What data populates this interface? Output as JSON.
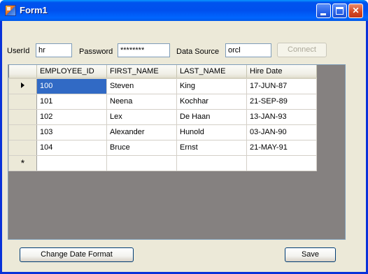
{
  "window": {
    "title": "Form1",
    "colors": {
      "titlebar": "#0054e3",
      "client": "#ece9d8",
      "selection": "#316ac5"
    }
  },
  "login": {
    "userid_label": "UserId",
    "userid_value": "hr",
    "password_label": "Password",
    "password_value": "********",
    "datasource_label": "Data Source",
    "datasource_value": "orcl",
    "connect_label": "Connect"
  },
  "grid": {
    "columns": [
      "EMPLOYEE_ID",
      "FIRST_NAME",
      "LAST_NAME",
      "Hire Date"
    ],
    "rows": [
      [
        "100",
        "Steven",
        "King",
        "17-JUN-87"
      ],
      [
        "101",
        "Neena",
        "Kochhar",
        "21-SEP-89"
      ],
      [
        "102",
        "Lex",
        "De Haan",
        "13-JAN-93"
      ],
      [
        "103",
        "Alexander",
        "Hunold",
        "03-JAN-90"
      ],
      [
        "104",
        "Bruce",
        "Ernst",
        "21-MAY-91"
      ]
    ],
    "new_row_marker": "*"
  },
  "footer": {
    "change_date_format_label": "Change Date Format",
    "save_label": "Save"
  }
}
